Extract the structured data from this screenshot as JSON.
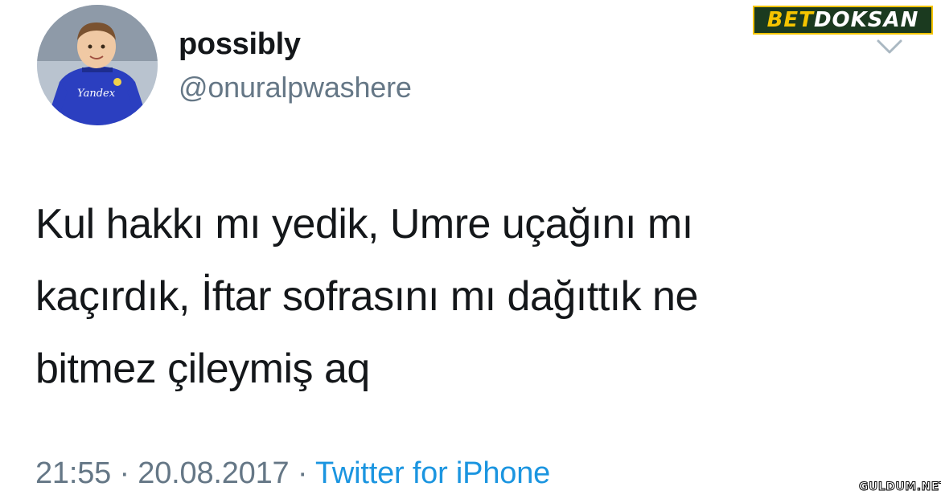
{
  "user": {
    "display_name": "possibly",
    "handle": "@onuralpwashere",
    "avatar_jersey_text": "Yandex"
  },
  "tweet": {
    "lines": [
      "Kul hakkı mı yedik, Umre uçağını mı",
      "kaçırdık, İftar sofrasını mı dağıttık ne",
      "bitmez çileymiş aq"
    ],
    "time": "21:55",
    "date": "20.08.2017",
    "separator": "·",
    "source": "Twitter for iPhone"
  },
  "menu": {
    "icon": "chevron-down-icon"
  },
  "watermarks": {
    "top_part1": "BET",
    "top_part2": "DOKSAN",
    "bottom": "GULDUM.NET"
  },
  "colors": {
    "text": "#14171a",
    "secondary": "#657786",
    "link": "#1b95e0",
    "jersey": "#2b3fc0"
  }
}
